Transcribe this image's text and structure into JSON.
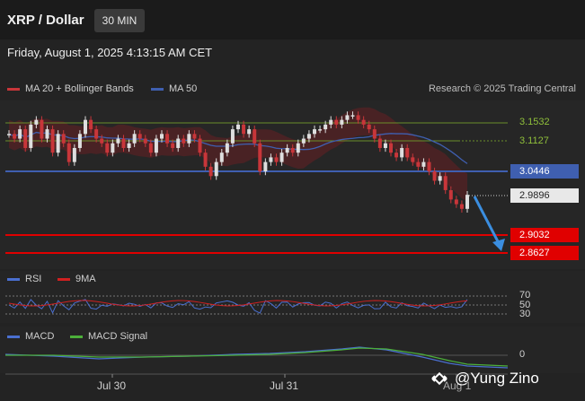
{
  "header": {
    "title": "XRP / Dollar",
    "timeframe_button": "30 MIN"
  },
  "datetime": "Friday, August 1, 2025 4:13:15 AM CET",
  "legend": {
    "bollinger_label": "MA 20 + Bollinger Bands",
    "ma50_label": "MA 50",
    "research_credit": "Research © 2025 Trading Central"
  },
  "colors": {
    "background": "#232323",
    "ma50": "#3f5fb0",
    "support_red": "#e00000",
    "bullish": "#dedede",
    "bearish": "#c8363a",
    "resistance_green": "#6a8f2a",
    "arrow": "#3b8ee0"
  },
  "price_levels": {
    "r1": "3.1532",
    "r2": "3.1127",
    "ma50_level": "3.0446",
    "current": "2.9896",
    "s1": "2.9032",
    "s2": "2.8627"
  },
  "rsi": {
    "label": "RSI",
    "ma_label": "9MA",
    "levels": [
      "70",
      "50",
      "30"
    ]
  },
  "macd": {
    "label": "MACD",
    "signal_label": "MACD Signal",
    "zero_label": "0"
  },
  "x_axis": {
    "labels": [
      "Jul 30",
      "Jul 31",
      "Aug 1"
    ]
  },
  "watermark": "@Yung Zino",
  "chart_data": {
    "type": "candlestick",
    "x_labels": [
      "Jul 30",
      "Jul 31",
      "Aug 1"
    ],
    "y_levels": [
      3.1532,
      3.1127,
      3.0446,
      2.9896,
      2.9032,
      2.8627
    ],
    "closes": [
      3.12,
      3.11,
      3.13,
      3.09,
      3.14,
      3.15,
      3.11,
      3.13,
      3.08,
      3.12,
      3.1,
      3.06,
      3.09,
      3.12,
      3.15,
      3.13,
      3.11,
      3.1,
      3.08,
      3.1,
      3.11,
      3.09,
      3.1,
      3.12,
      3.11,
      3.1,
      3.08,
      3.11,
      3.12,
      3.1,
      3.09,
      3.11,
      3.1,
      3.12,
      3.11,
      3.08,
      3.05,
      3.03,
      3.06,
      3.08,
      3.1,
      3.13,
      3.14,
      3.12,
      3.13,
      3.1,
      3.04,
      3.06,
      3.07,
      3.06,
      3.08,
      3.09,
      3.08,
      3.1,
      3.11,
      3.12,
      3.13,
      3.13,
      3.14,
      3.15,
      3.14,
      3.15,
      3.16,
      3.16,
      3.15,
      3.14,
      3.13,
      3.11,
      3.09,
      3.1,
      3.08,
      3.07,
      3.09,
      3.07,
      3.06,
      3.05,
      3.06,
      3.04,
      3.02,
      3.03,
      3.0,
      2.98,
      2.97,
      2.96,
      2.99
    ]
  }
}
